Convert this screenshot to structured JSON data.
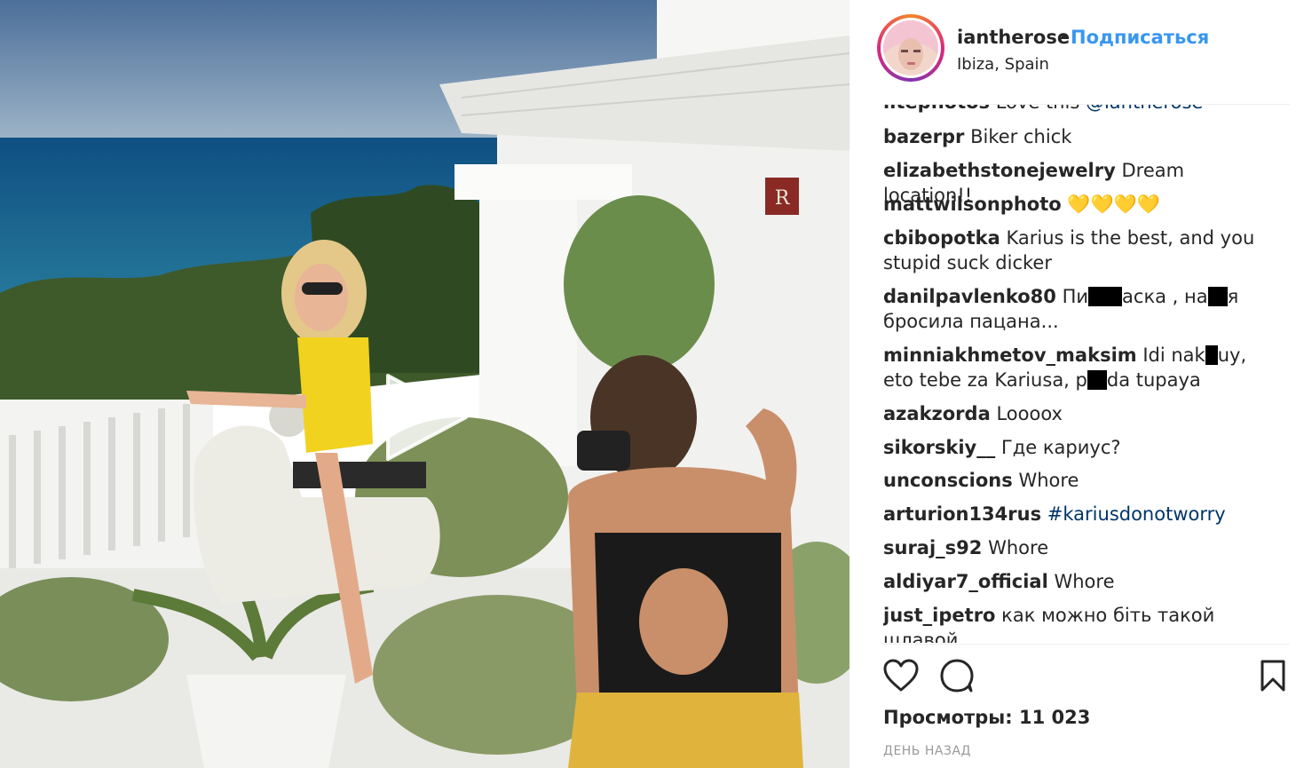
{
  "post": {
    "username": "iantherose",
    "separator": "•",
    "follow_label": "Подписаться",
    "location": "Ibiza, Spain"
  },
  "comments": [
    {
      "user": "litephotos",
      "text": "Love this ",
      "mention": "@iantherose"
    },
    {
      "user": "bazerpr",
      "text": "Biker chick"
    },
    {
      "user": "elizabethstonejewelry",
      "text": "Dream location!!"
    },
    {
      "user": "mattwilsonphoto",
      "text": "💛💛💛💛"
    },
    {
      "user": "cbibopotka",
      "text": "Karius is the best, and you stupid suck dicker"
    },
    {
      "user": "danilpavlenko80",
      "text_a": "Пи",
      "text_b": "аска , на",
      "text_c": "я бросила пацана..."
    },
    {
      "user": "minniakhmetov_maksim",
      "text_a": "Idi nak",
      "text_b": "uy, eto tebe za Kariusa, p",
      "text_c": "da tupaya"
    },
    {
      "user": "azakzorda",
      "text": "Loooox"
    },
    {
      "user": "sikorskiy__",
      "text": "Где кариус?"
    },
    {
      "user": "unconscions",
      "text": "Whore"
    },
    {
      "user": "arturion134rus",
      "hashtag": "#kariusdonotworry"
    },
    {
      "user": "suraj_s92",
      "text": "Whore"
    },
    {
      "user": "aldiyar7_official",
      "text": "Whore"
    },
    {
      "user": "just_ipetro",
      "text": "как можно біть такой шлавой"
    }
  ],
  "stats": {
    "views": "Просмотры: 11 023",
    "age": "ДЕНЬ НАЗАД"
  },
  "icons": {
    "like": "heart-icon",
    "comment": "comment-bubble-icon",
    "save": "bookmark-icon",
    "play": "play-icon"
  },
  "colors": {
    "link": "#3897f0",
    "hashtag": "#003569",
    "text": "#262626",
    "muted": "#999999"
  }
}
